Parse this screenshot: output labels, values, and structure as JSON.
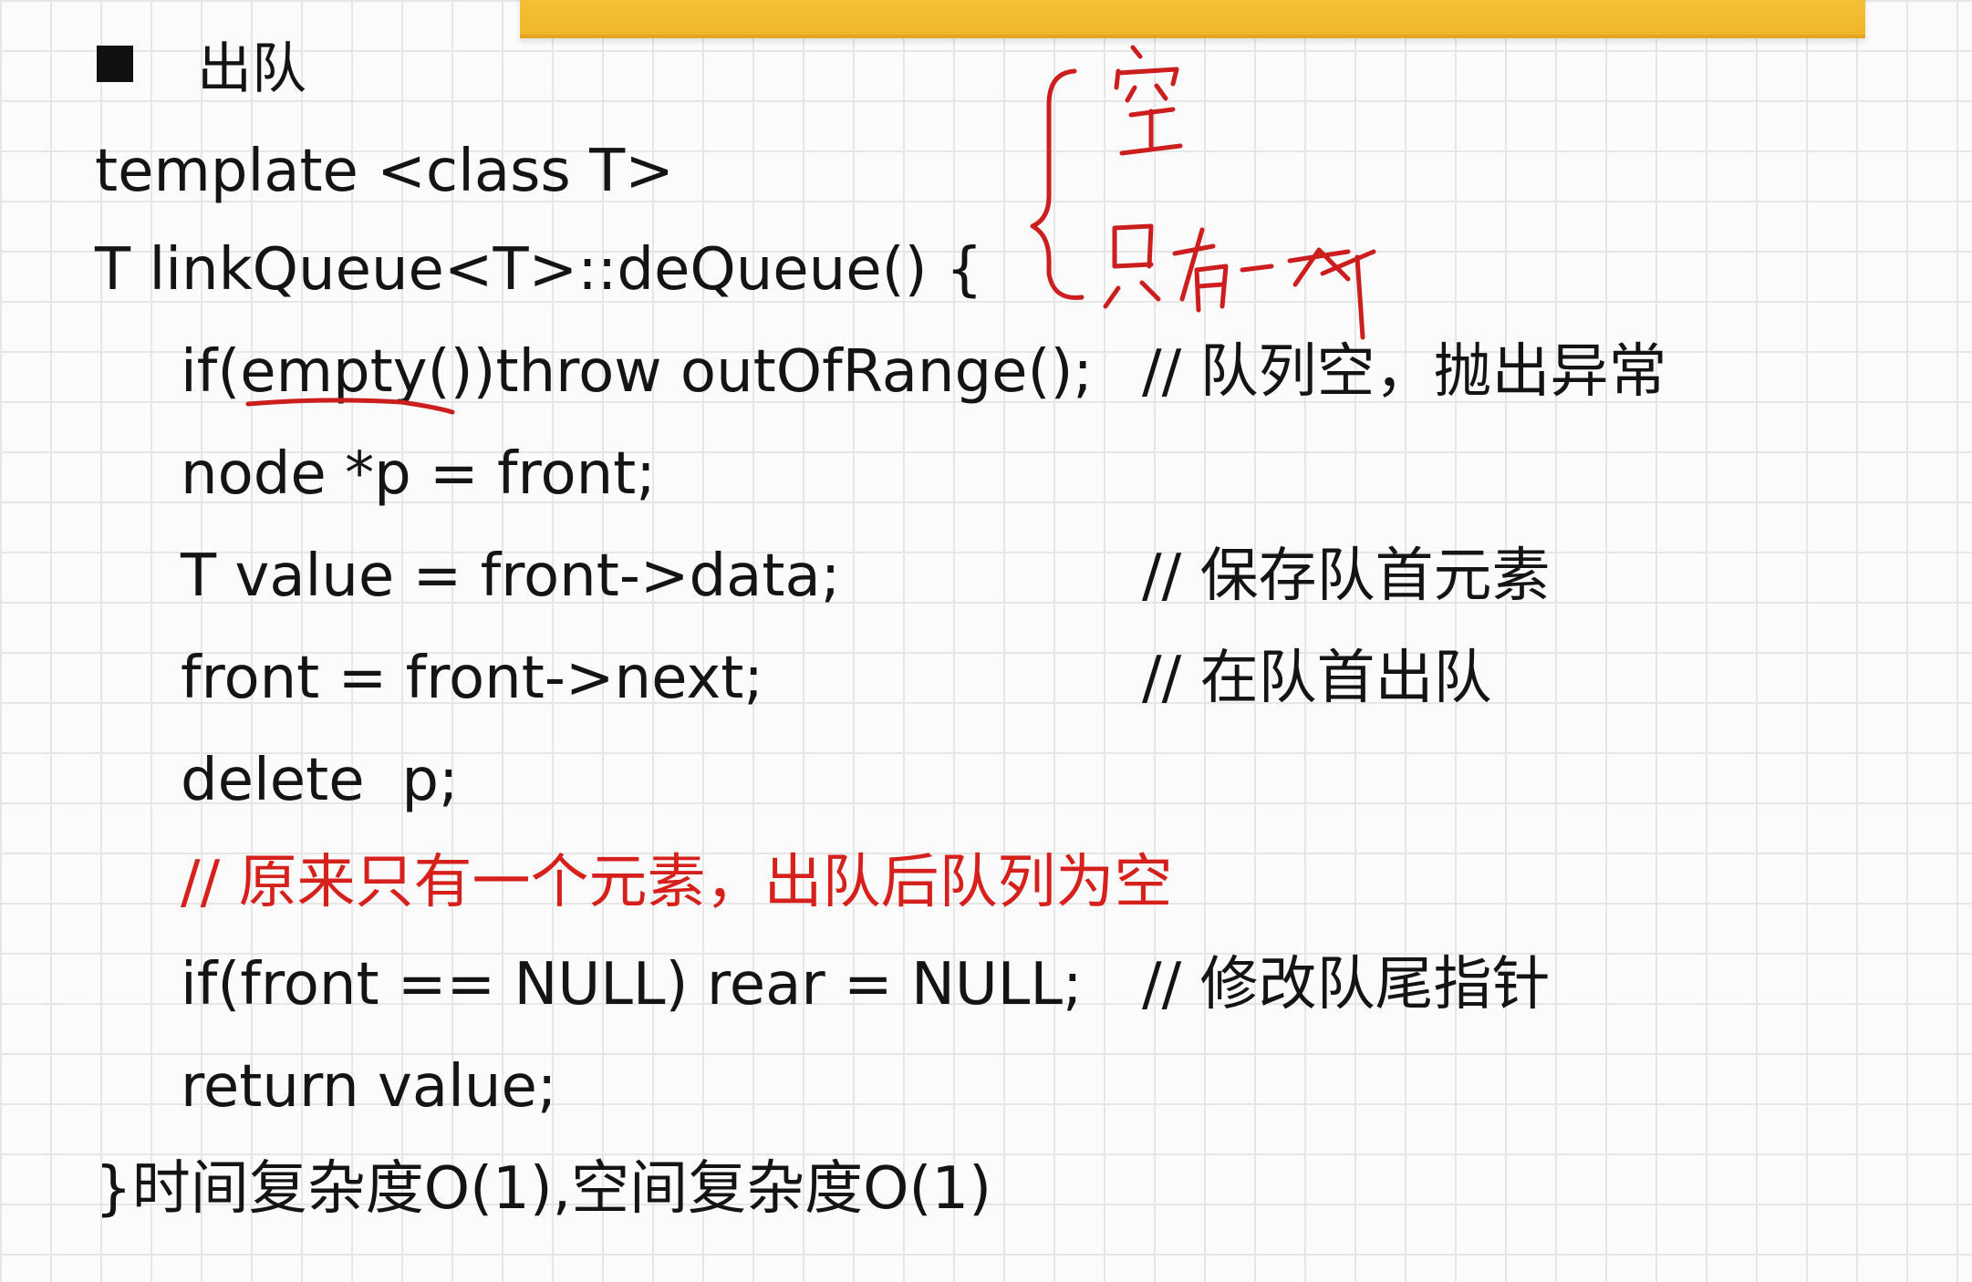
{
  "section": {
    "title": "出队"
  },
  "code": {
    "line1": "template <class T>",
    "line2": "T linkQueue<T>::deQueue() {",
    "line3_code": "if(empty())throw outOfRange();",
    "line3_comment": "// 队列空，抛出异常",
    "line4_code": "node *p = front;",
    "line5_code": "T value = front->data;",
    "line5_comment": "// 保存队首元素",
    "line6_code": "front = front->next;",
    "line6_comment": "// 在队首出队",
    "line7_code": "delete  p;",
    "line8_red_comment": "// 原来只有一个元素，出队后队列为空",
    "line9_code": "if(front == NULL) rear = NULL;",
    "line9_comment": "// 修改队尾指针",
    "line10_code": "return value;",
    "line11": "}时间复杂度O(1),空间复杂度O(1)"
  },
  "annotations": {
    "handwritten_note_1": "空",
    "handwritten_note_2": "只有一个"
  },
  "colors": {
    "banner": "#f0b62a",
    "red_text": "#d6201c",
    "ink": "#cc1e1e",
    "text": "#141414",
    "grid": "#e6e6e6"
  }
}
